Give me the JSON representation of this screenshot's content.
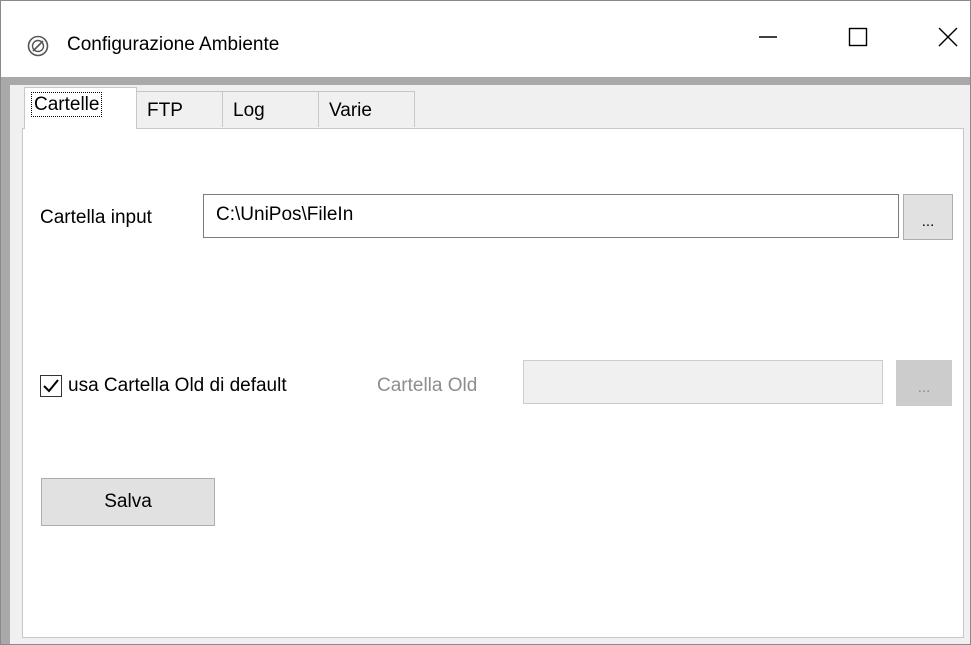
{
  "window": {
    "title": "Configurazione Ambiente",
    "icon": "settings-disc-icon"
  },
  "caption_buttons": {
    "minimize_icon": "minimize-icon",
    "maximize_icon": "maximize-icon",
    "close_icon": "close-icon"
  },
  "tabs": [
    {
      "label": "Cartelle",
      "active": true
    },
    {
      "label": "FTP",
      "active": false
    },
    {
      "label": "Log",
      "active": false
    },
    {
      "label": "Varie",
      "active": false
    }
  ],
  "cartelle": {
    "input_label": "Cartella input",
    "input_value": "C:\\UniPos\\FileIn",
    "input_browse_label": "...",
    "use_old_checkbox_label": "usa Cartella Old di default",
    "use_old_checked": true,
    "old_label": "Cartella Old",
    "old_value": "",
    "old_browse_label": "...",
    "save_label": "Salva"
  },
  "colors": {
    "window_bg": "#f0f0f0",
    "panel_bg": "#ffffff",
    "disabled_text": "#8d8d8d",
    "button_face": "#e1e1e1"
  }
}
